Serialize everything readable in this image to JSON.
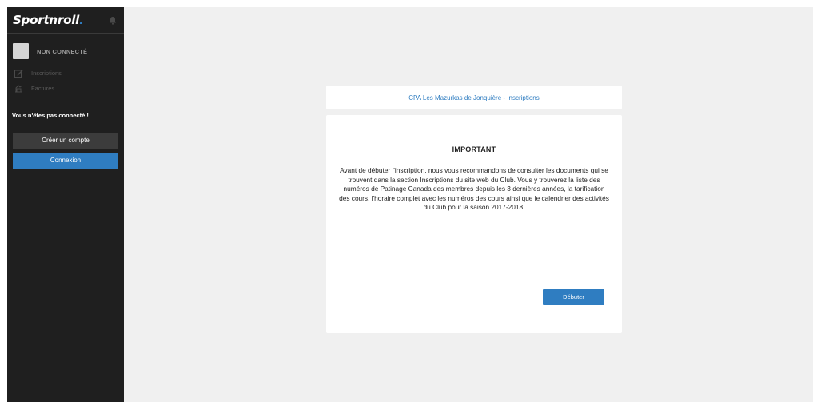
{
  "sidebar": {
    "logo_text": "Sportnroll",
    "logo_dot": ".",
    "user_status": "NON CONNECTÉ",
    "nav": [
      {
        "label": "Inscriptions",
        "icon": "edit-icon"
      },
      {
        "label": "Factures",
        "icon": "invoice-icon"
      }
    ],
    "not_connected_message": "Vous n'êtes pas connecté !",
    "create_account_label": "Créer un compte",
    "login_label": "Connexion"
  },
  "main": {
    "title": "CPA Les Mazurkas de Jonquière - Inscriptions",
    "heading": "IMPORTANT",
    "body": "Avant de débuter l'inscription, nous vous recommandons de consulter les documents qui se trouvent dans la section Inscriptions du site web du Club. Vous y trouverez la liste des numéros de Patinage Canada des membres depuis les 3 dernières années, la tarification des cours, l'horaire complet avec les numéros des cours ainsi que le calendrier des activités du Club pour la saison 2017-2018.",
    "start_label": "Débuter"
  },
  "colors": {
    "sidebar_bg": "#1f1f1f",
    "accent": "#2f7dc1",
    "main_bg": "#f0f0f0"
  }
}
